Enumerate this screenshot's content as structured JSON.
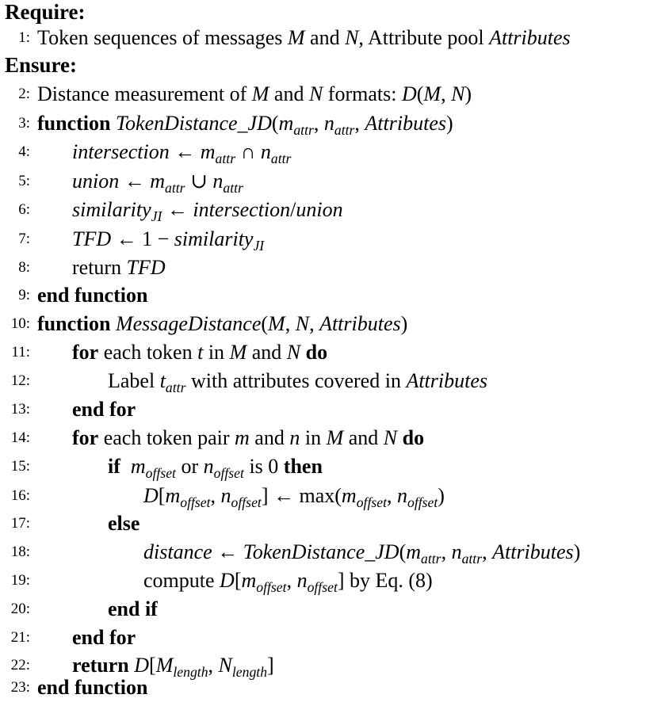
{
  "header": {
    "require": "Require:",
    "ensure": "Ensure:"
  },
  "lines": [
    {
      "num": "1:",
      "text": "Token sequences of messages M and N, Attribute pool Attributes"
    },
    {
      "num": "2:",
      "text": "Distance measurement of M and N formats: D(M, N)"
    },
    {
      "num": "3:",
      "text": "function TokenDistance_JD(m_attr, n_attr, Attributes)"
    },
    {
      "num": "4:",
      "text": "intersection ← m_attr ∩ n_attr"
    },
    {
      "num": "5:",
      "text": "union ← m_attr ∪ n_attr"
    },
    {
      "num": "6:",
      "text": "similarity_JI ← intersection/union"
    },
    {
      "num": "7:",
      "text": "TFD ← 1 − similarity_JI"
    },
    {
      "num": "8:",
      "text": "return TFD"
    },
    {
      "num": "9:",
      "text": "end function"
    },
    {
      "num": "10:",
      "text": "function MessageDistance(M, N, Attributes)"
    },
    {
      "num": "11:",
      "text": "for each token t in M and N do"
    },
    {
      "num": "12:",
      "text": "Label t_attr with attributes covered in Attributes"
    },
    {
      "num": "13:",
      "text": "end for"
    },
    {
      "num": "14:",
      "text": "for each token pair m and n in M and N do"
    },
    {
      "num": "15:",
      "text": "if m_offset or n_offset is 0 then"
    },
    {
      "num": "16:",
      "text": "D[m_offset, n_offset] ← max(m_offset, n_offset)"
    },
    {
      "num": "17:",
      "text": "else"
    },
    {
      "num": "18:",
      "text": "distance ← TokenDistance_JD(m_attr, n_attr, Attributes)"
    },
    {
      "num": "19:",
      "text": "compute D[m_offset, n_offset] by Eq. (8)"
    },
    {
      "num": "20:",
      "text": "end if"
    },
    {
      "num": "21:",
      "text": "end for"
    },
    {
      "num": "22:",
      "text": "return D[M_length, N_length]"
    },
    {
      "num": "23:",
      "text": "end function"
    }
  ]
}
